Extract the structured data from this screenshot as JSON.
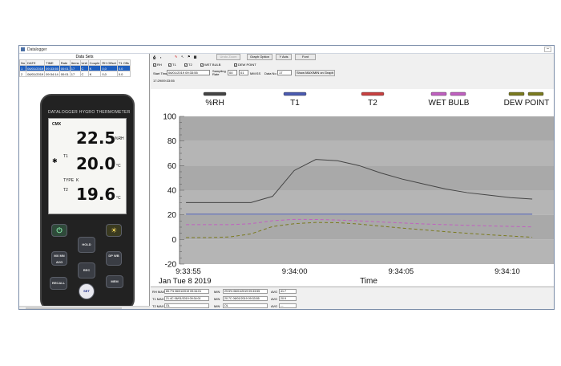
{
  "window": {
    "title": "Datalogger"
  },
  "dataset": {
    "title": "Data Sets",
    "columns": [
      "No",
      "DATE",
      "TIME",
      "Rate",
      "Items",
      "Unit",
      "Couple",
      "RH Offset",
      "T1 Offs"
    ],
    "rows": [
      [
        "1",
        "06/01/2019",
        "09:33:55",
        "00:01",
        "17",
        "C",
        "K",
        "0,0",
        "0.0"
      ],
      [
        "2",
        "06/01/2019",
        "09:34:14",
        "00:01",
        "17",
        "C",
        "K",
        "0,0",
        "0.0"
      ]
    ]
  },
  "device": {
    "header": "DATALOGGER HYGRO THERMOMETER",
    "indicator": "CMX",
    "rh_value": "22.5",
    "rh_unit": "%RH",
    "t1_label": "T1",
    "t1_value": "20.0",
    "t1_unit": "°C",
    "type_label": "TYPE",
    "type_value": "K",
    "t2_label": "T2",
    "t2_value": "19.6",
    "t2_unit": "°C",
    "keys": {
      "hold": "HOLD",
      "maxmin": "MX MN AVG",
      "dp": "DP WB",
      "rec": "REC",
      "recall": "RECALL",
      "mem": "MEM",
      "set": "SET"
    }
  },
  "toolbar": {
    "zoom_label": "Undo Zoom",
    "graph_options": "Graph Option",
    "y_axis": "Y Axis",
    "font": "Font",
    "series_checks": [
      "RH",
      "T1",
      "T2",
      "WET BULB",
      "DEW POINT"
    ],
    "start_time_label": "Start Time",
    "start_time_value": "06/01/2019 09:33:55",
    "sampling_label": "Sampling Rate",
    "sampling_min": "00",
    "sampling_sec": "01",
    "sampling_unit": "MM:SS",
    "data_no_label": "Data No",
    "data_no_value": "17",
    "show_button": "Show MAX/MIN on Graph",
    "time_range_text": "17:29/09:33:55"
  },
  "chart_data": {
    "type": "line",
    "ylim": [
      -20,
      100
    ],
    "yticks": [
      "100",
      "80",
      "60",
      "40",
      "20",
      "0",
      "-20"
    ],
    "xticks": [
      "9:33:55",
      "9:34:00",
      "9:34:05",
      "9:34:10"
    ],
    "xlabel": "Time",
    "date_label": "Jan Tue 8 2019",
    "legend_position": "top",
    "series": [
      {
        "name": "%RH",
        "color": "#444444",
        "x": [
          0,
          1,
          2,
          3,
          4,
          5,
          6,
          7,
          8,
          9,
          10,
          11,
          12,
          13,
          14,
          15,
          16
        ],
        "values": [
          30,
          30,
          30,
          30,
          35,
          56,
          65,
          64,
          60,
          54,
          49,
          45,
          41,
          38,
          36,
          34,
          32.8
        ]
      },
      {
        "name": "T1",
        "color": "#4a5ab0",
        "x": [
          0,
          16
        ],
        "values": [
          20.5,
          20.5
        ]
      },
      {
        "name": "T2",
        "color": "#c84040",
        "x": [],
        "values": []
      },
      {
        "name": "WET BULB",
        "color": "#c060c0",
        "x": [
          0,
          1,
          2,
          3,
          4,
          5,
          6,
          7,
          8,
          9,
          10,
          11,
          12,
          13,
          14,
          15,
          16
        ],
        "values": [
          12,
          12,
          12,
          12.8,
          15.2,
          16.3,
          16.2,
          15.8,
          15.1,
          14.2,
          13.4,
          12.6,
          12,
          11.5,
          11,
          10.6,
          10.2
        ]
      },
      {
        "name": "DEW POINT",
        "color": "#7a7a1e",
        "x": [
          0,
          1,
          2,
          3,
          4,
          5,
          6,
          7,
          8,
          9,
          10,
          11,
          12,
          13,
          14,
          15,
          16
        ],
        "values": [
          1.5,
          1.5,
          2,
          4.5,
          10.5,
          12.8,
          13.8,
          13.6,
          12.5,
          10.8,
          9.2,
          7.8,
          6.3,
          5,
          3.8,
          2.8,
          1.8
        ]
      }
    ]
  },
  "stats": {
    "rh_max_label": "RH MAX",
    "rh_max_value": "65.7% 06/01/2019 09:34:01",
    "rh_min_label": "MIN",
    "rh_min_value": "29.5% 06/01/2019 09:33:55",
    "rh_avg_label": "AVG",
    "rh_avg_value": "41.7",
    "t1_max_label": "T1 MAX",
    "t1_max_value": "21.4C 06/01/2019 09:34:01",
    "t1_min_label": "MIN",
    "t1_min_value": "20.7C 06/01/2019 09:33:55",
    "t1_avg_label": "AVG",
    "t1_avg_value": "20.9",
    "t2_max_label": "T2 MAX",
    "t2_max_value": "OL",
    "t2_min_label": "MIN",
    "t2_min_value": "OL",
    "t2_avg_label": "AVG",
    "t2_avg_value": "---"
  },
  "colors": {
    "plot_band_dark": "#a9a9a9",
    "plot_band_light": "#b5b5b5",
    "selection": "#1f5fbf"
  }
}
